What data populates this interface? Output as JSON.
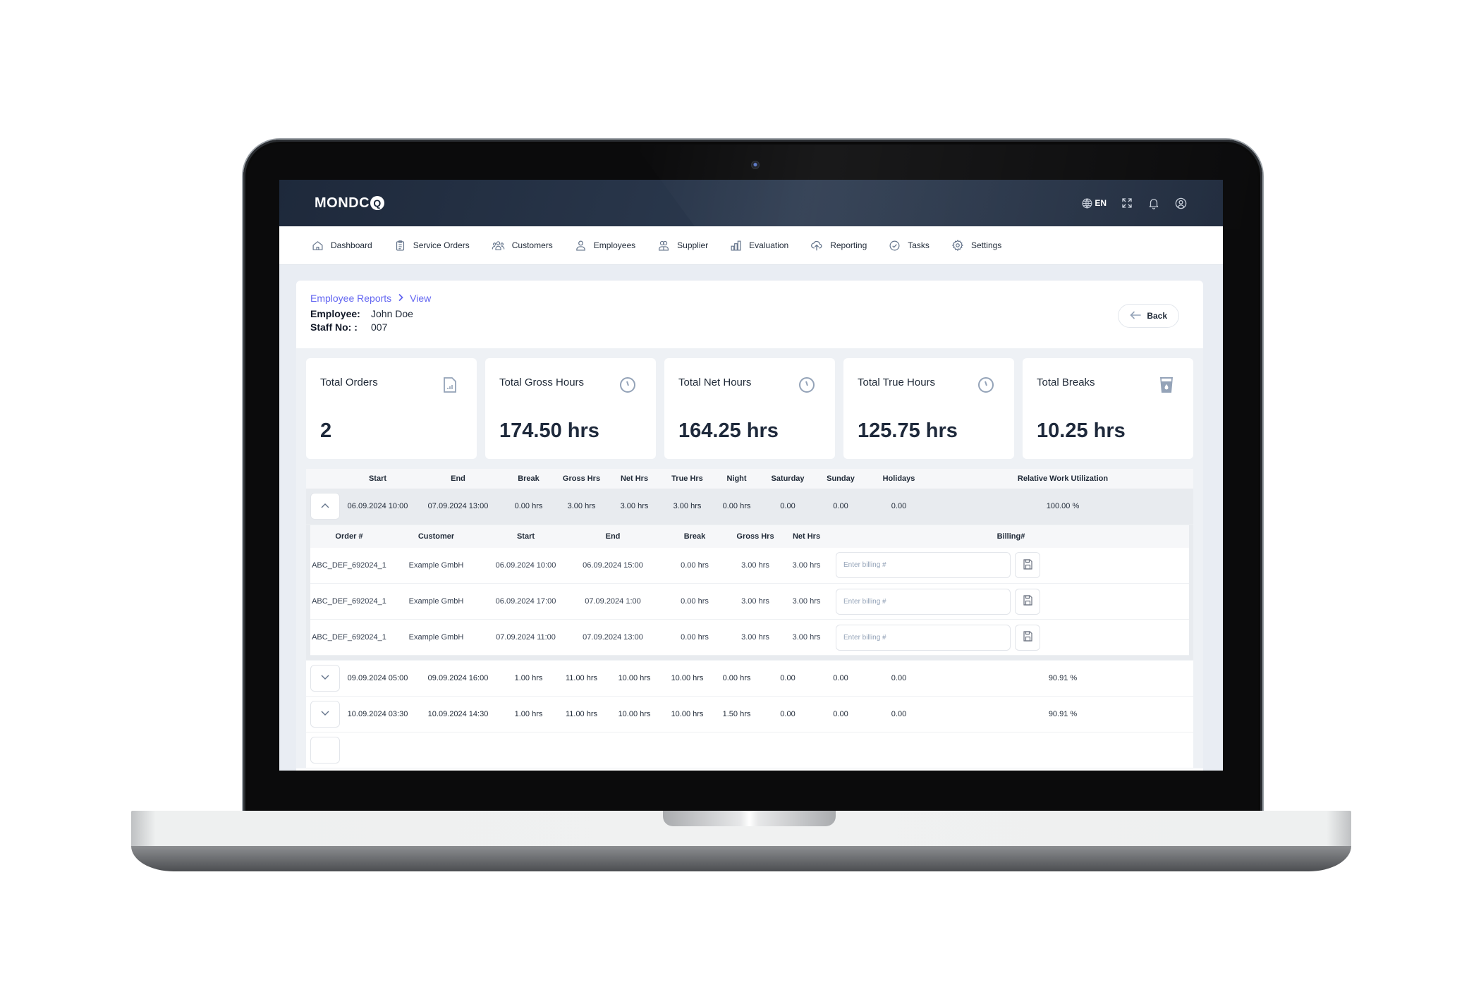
{
  "app": {
    "logo_text": "MONDC",
    "logo_mark": "Q",
    "language": "EN",
    "icons": {
      "language": "globe-icon",
      "fullscreen": "expand-icon",
      "notifications": "bell-icon",
      "account": "user-circle-icon"
    }
  },
  "nav": {
    "items": [
      {
        "label": "Dashboard",
        "icon": "home-icon"
      },
      {
        "label": "Service Orders",
        "icon": "clipboard-icon"
      },
      {
        "label": "Customers",
        "icon": "users-group-icon"
      },
      {
        "label": "Employees",
        "icon": "user-icon"
      },
      {
        "label": "Supplier",
        "icon": "supplier-icon"
      },
      {
        "label": "Evaluation",
        "icon": "bar-chart-icon"
      },
      {
        "label": "Reporting",
        "icon": "cloud-upload-icon"
      },
      {
        "label": "Tasks",
        "icon": "check-circle-icon"
      },
      {
        "label": "Settings",
        "icon": "gear-icon"
      }
    ]
  },
  "page": {
    "breadcrumb": [
      "Employee Reports",
      "View"
    ],
    "employee_label": "Employee:",
    "employee_value": "John Doe",
    "staff_label": "Staff No: :",
    "staff_value": "007",
    "back_label": "Back"
  },
  "stats": [
    {
      "title": "Total Orders",
      "value": "2",
      "icon": "document-chart-icon"
    },
    {
      "title": "Total Gross Hours",
      "value": "174.50 hrs",
      "icon": "clock-icon"
    },
    {
      "title": "Total Net Hours",
      "value": "164.25 hrs",
      "icon": "clock-icon"
    },
    {
      "title": "Total True Hours",
      "value": "125.75 hrs",
      "icon": "clock-icon"
    },
    {
      "title": "Total Breaks",
      "value": "10.25 hrs",
      "icon": "cup-icon"
    }
  ],
  "report_table": {
    "columns": [
      "",
      "Start",
      "End",
      "Break",
      "Gross Hrs",
      "Net Hrs",
      "True Hrs",
      "Night",
      "Saturday",
      "Sunday",
      "Holidays",
      "Relative Work Utilization"
    ],
    "rows": [
      {
        "expanded": true,
        "cells": [
          "06.09.2024 10:00",
          "07.09.2024 13:00",
          "0.00 hrs",
          "3.00 hrs",
          "3.00 hrs",
          "3.00 hrs",
          "0.00 hrs",
          "0.00",
          "0.00",
          "0.00",
          "100.00 %"
        ]
      },
      {
        "expanded": false,
        "cells": [
          "09.09.2024 05:00",
          "09.09.2024 16:00",
          "1.00 hrs",
          "11.00 hrs",
          "10.00 hrs",
          "10.00 hrs",
          "0.00 hrs",
          "0.00",
          "0.00",
          "0.00",
          "90.91 %"
        ]
      },
      {
        "expanded": false,
        "cells": [
          "10.09.2024 03:30",
          "10.09.2024 14:30",
          "1.00 hrs",
          "11.00 hrs",
          "10.00 hrs",
          "10.00 hrs",
          "1.50 hrs",
          "0.00",
          "0.00",
          "0.00",
          "90.91 %"
        ]
      }
    ]
  },
  "orders_table": {
    "columns": [
      "Order #",
      "Customer",
      "Start",
      "End",
      "Break",
      "Gross Hrs",
      "Net Hrs",
      "Billing#"
    ],
    "billing_placeholder": "Enter billing #",
    "rows": [
      {
        "cells": [
          "ABC_DEF_692024_1",
          "Example GmbH",
          "06.09.2024 10:00",
          "06.09.2024 15:00",
          "0.00 hrs",
          "3.00 hrs",
          "3.00 hrs"
        ],
        "billing": ""
      },
      {
        "cells": [
          "ABC_DEF_692024_1",
          "Example GmbH",
          "06.09.2024 17:00",
          "07.09.2024 1:00",
          "0.00 hrs",
          "3.00 hrs",
          "3.00 hrs"
        ],
        "billing": ""
      },
      {
        "cells": [
          "ABC_DEF_692024_1",
          "Example GmbH",
          "07.09.2024 11:00",
          "07.09.2024 13:00",
          "0.00 hrs",
          "3.00 hrs",
          "3.00 hrs"
        ],
        "billing": ""
      }
    ]
  }
}
